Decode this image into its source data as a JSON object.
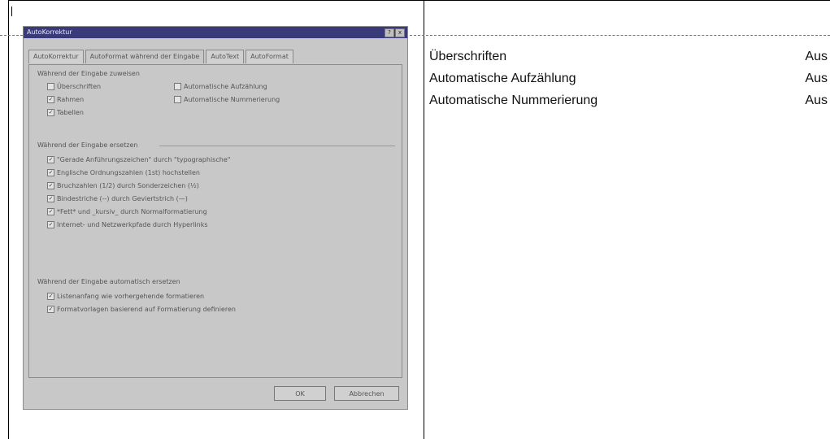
{
  "dialog": {
    "title": "AutoKorrektur",
    "title_buttons": [
      "?",
      "x"
    ],
    "tabs": [
      {
        "label": "AutoKorrektur"
      },
      {
        "label": "AutoFormat während der Eingabe"
      },
      {
        "label": "AutoText"
      },
      {
        "label": "AutoFormat"
      }
    ],
    "group1_title": "Während der Eingabe zuweisen",
    "group1_items": [
      {
        "label": "Überschriften",
        "checked": false
      },
      {
        "label": "Rahmen",
        "checked": true
      },
      {
        "label": "Tabellen",
        "checked": true
      },
      {
        "label": "Automatische Aufzählung",
        "checked": false
      },
      {
        "label": "Automatische Nummerierung",
        "checked": false
      }
    ],
    "group2_title": "Während der Eingabe ersetzen",
    "group2_items": [
      {
        "label": "\"Gerade Anführungszeichen\" durch \"typographische\"",
        "checked": true
      },
      {
        "label": "Englische Ordnungszahlen (1st) hochstellen",
        "checked": true
      },
      {
        "label": "Bruchzahlen (1/2) durch Sonderzeichen (½)",
        "checked": true
      },
      {
        "label": "Bindestriche (--) durch Geviertstrich (—)",
        "checked": true
      },
      {
        "label": "*Fett* und _kursiv_ durch Normalformatierung",
        "checked": true
      },
      {
        "label": "Internet- und Netzwerkpfade durch Hyperlinks",
        "checked": true
      }
    ],
    "group3_title": "Während der Eingabe automatisch ersetzen",
    "group3_items": [
      {
        "label": "Listenanfang wie vorhergehende formatieren",
        "checked": true
      },
      {
        "label": "Formatvorlagen basierend auf Formatierung definieren",
        "checked": true
      }
    ],
    "ok_label": "OK",
    "cancel_label": "Abbrechen"
  },
  "settings": {
    "rows": [
      {
        "name": "Überschriften",
        "value": "Aus"
      },
      {
        "name": "Automatische Aufzählung",
        "value": "Aus"
      },
      {
        "name": "Automatische Nummerierung",
        "value": "Aus"
      }
    ]
  }
}
